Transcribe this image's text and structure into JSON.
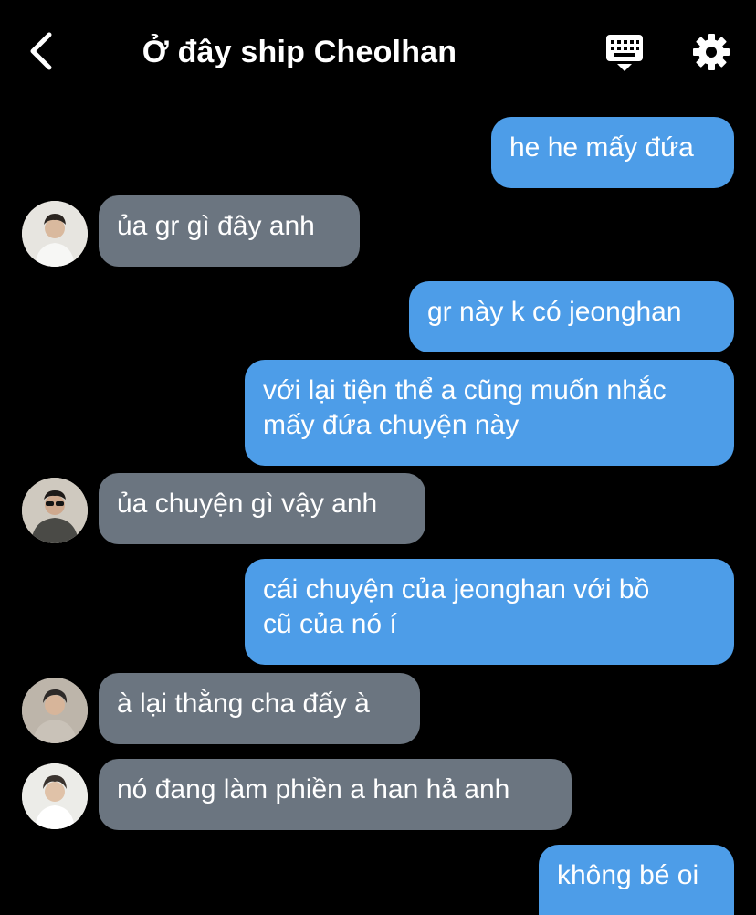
{
  "header": {
    "title": "Ở đây ship Cheolhan",
    "back_icon": "chevron-left-icon",
    "keyboard_icon": "keyboard-icon",
    "settings_icon": "gear-icon"
  },
  "colors": {
    "background": "#000000",
    "outgoing_bubble": "#4d9de8",
    "incoming_bubble": "#6b7580",
    "text": "#ffffff"
  },
  "messages": [
    {
      "direction": "outgoing",
      "lines": [
        "he he mấy đứa"
      ]
    },
    {
      "direction": "incoming",
      "lines": [
        "ủa gr gì đây anh"
      ]
    },
    {
      "direction": "outgoing",
      "lines": [
        "gr này k có jeonghan"
      ]
    },
    {
      "direction": "outgoing",
      "lines": [
        "với lại tiện thể a cũng muốn nhắc",
        "mấy đứa chuyện này"
      ]
    },
    {
      "direction": "incoming",
      "lines": [
        "ủa chuyện gì vậy anh"
      ]
    },
    {
      "direction": "outgoing",
      "lines": [
        "cái chuyện của jeonghan với bồ",
        "cũ của nó í"
      ]
    },
    {
      "direction": "incoming",
      "lines": [
        "à lại thằng cha đấy à"
      ]
    },
    {
      "direction": "incoming",
      "lines": [
        "nó đang làm phiền a han hả anh"
      ]
    },
    {
      "direction": "outgoing",
      "lines": [
        "không bé oi"
      ]
    }
  ]
}
